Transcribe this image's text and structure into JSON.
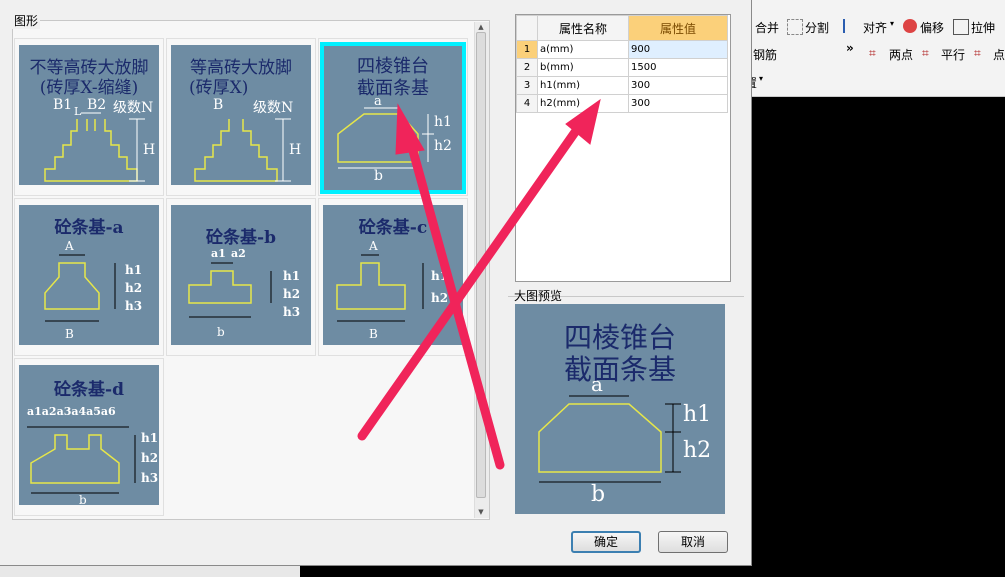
{
  "background_toolbar": {
    "row1": [
      "合并",
      "分割",
      "对齐",
      "偏移",
      "拉伸"
    ],
    "row2": [
      "钢筋",
      "两点",
      "平行",
      "点"
    ],
    "row3": [
      "置"
    ]
  },
  "dialog": {
    "group_label": "图形",
    "shapes": [
      {
        "id": "brick-unequal",
        "title": [
          "不等高砖大放脚",
          "(砖厚X-缩缝)"
        ],
        "labels": [
          "B1",
          "L",
          "B2",
          "级数N",
          "H"
        ]
      },
      {
        "id": "brick-equal",
        "title": [
          "等高砖大放脚",
          "(砖厚X)"
        ],
        "labels": [
          "B",
          "级数N",
          "H"
        ]
      },
      {
        "id": "pyramid",
        "title": [
          "四棱锥台",
          "截面条基"
        ],
        "labels": [
          "a",
          "h1",
          "h2",
          "b"
        ],
        "selected": true
      },
      {
        "id": "concrete-a",
        "title": [
          "砼条基-a"
        ],
        "labels": [
          "A",
          "h1",
          "h2",
          "h3",
          "B"
        ]
      },
      {
        "id": "concrete-b",
        "title": [
          "砼条基-b"
        ],
        "labels": [
          "a1",
          "a2",
          "h1",
          "h2",
          "h3",
          "b"
        ]
      },
      {
        "id": "concrete-c",
        "title": [
          "砼条基-c"
        ],
        "labels": [
          "A",
          "h1",
          "h2",
          "B"
        ]
      },
      {
        "id": "concrete-d",
        "title": [
          "砼条基-d"
        ],
        "labels": [
          "a1a2a3a4a5a6",
          "h1",
          "h2",
          "h3",
          "b"
        ]
      }
    ],
    "properties": {
      "header_name": "属性名称",
      "header_value": "属性值",
      "rows": [
        {
          "no": "1",
          "name": "a(mm)",
          "value": "900"
        },
        {
          "no": "2",
          "name": "b(mm)",
          "value": "1500"
        },
        {
          "no": "3",
          "name": "h1(mm)",
          "value": "300"
        },
        {
          "no": "4",
          "name": "h2(mm)",
          "value": "300"
        }
      ]
    },
    "preview_label": "大图预览",
    "preview": {
      "title": [
        "四棱锥台",
        "截面条基"
      ],
      "labels": [
        "a",
        "h1",
        "h2",
        "b"
      ]
    },
    "ok_label": "确定",
    "cancel_label": "取消"
  },
  "colors": {
    "thumb_bg": "#6e8ca3",
    "selected_border": "#00f0ff",
    "shape_line": "#e6e64a",
    "arrow": "#f0245a"
  }
}
